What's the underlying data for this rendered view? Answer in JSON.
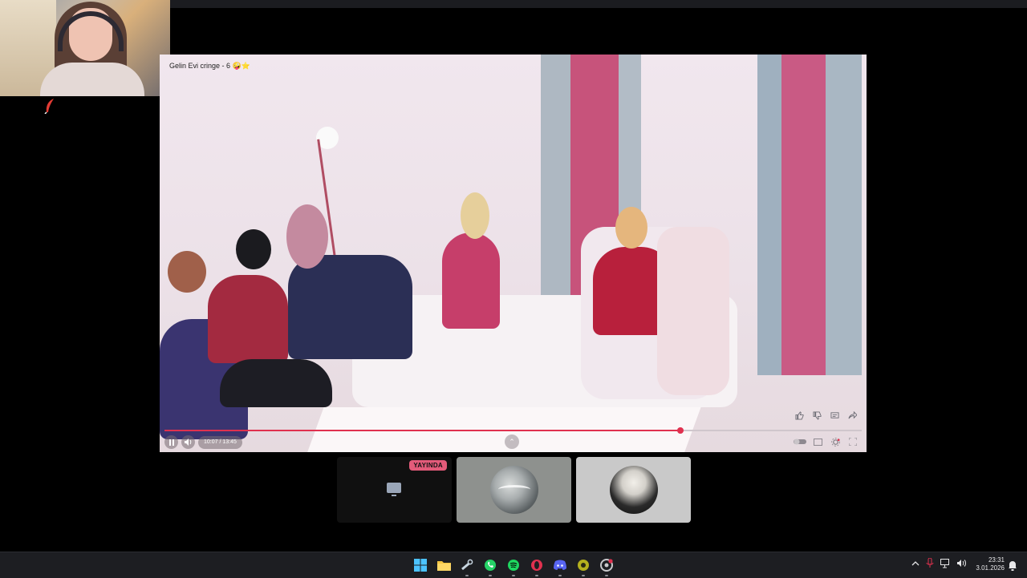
{
  "video": {
    "title": "Gelin Evi cringe - 6 🤪⭐",
    "time": "10:07 / 13:45",
    "progress_fraction": 0.74,
    "actions": [
      "like-icon",
      "dislike-icon",
      "chat-icon",
      "share-icon"
    ]
  },
  "tiles": {
    "live_label": "YAYINDA"
  },
  "taskbar": {
    "apps": [
      "windows-start-icon",
      "file-explorer-icon",
      "steam-icon",
      "whatsapp-icon",
      "spotify-icon",
      "opera-icon",
      "discord-icon",
      "app-icon",
      "chrome-icon"
    ],
    "time": "23:31",
    "date": "3.01.2026"
  },
  "colors": {
    "accent": "#e0314f",
    "live_badge": "#e35b7a",
    "taskbar_bg": "#1d1e22"
  }
}
